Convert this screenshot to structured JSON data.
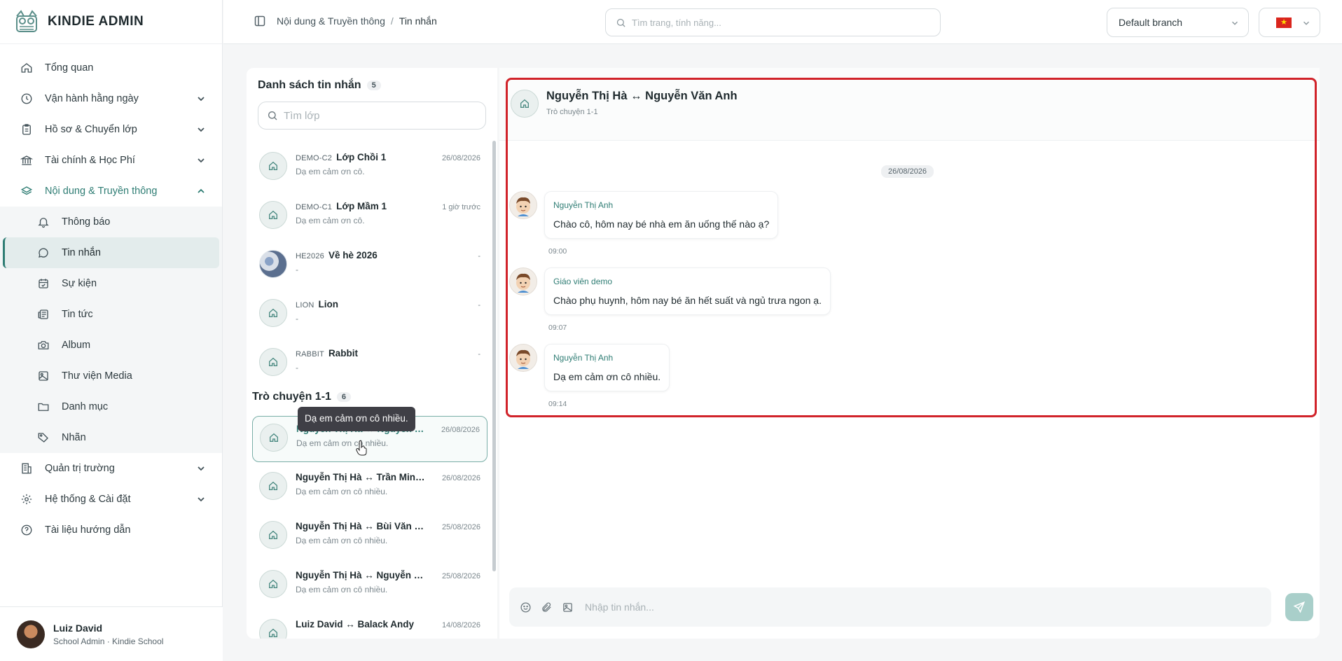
{
  "brand": {
    "name": "KINDIE ADMIN"
  },
  "sidebar": {
    "items": [
      {
        "label": "Tổng quan",
        "icon": "home-icon"
      },
      {
        "label": "Vận hành hằng ngày",
        "icon": "clock-icon"
      },
      {
        "label": "Hồ sơ & Chuyển lớp",
        "icon": "clipboard-icon"
      },
      {
        "label": "Tài chính & Học Phí",
        "icon": "bank-icon"
      },
      {
        "label": "Nội dung & Truyền thông",
        "icon": "layers-icon"
      }
    ],
    "sub_items": [
      {
        "label": "Thông báo",
        "icon": "bell-icon"
      },
      {
        "label": "Tin nhắn",
        "icon": "chat-icon"
      },
      {
        "label": "Sự kiện",
        "icon": "calendar-icon"
      },
      {
        "label": "Tin tức",
        "icon": "newspaper-icon"
      },
      {
        "label": "Album",
        "icon": "camera-icon"
      },
      {
        "label": "Thư viện Media",
        "icon": "image-icon"
      },
      {
        "label": "Danh mục",
        "icon": "folder-icon"
      },
      {
        "label": "Nhãn",
        "icon": "tag-icon"
      }
    ],
    "bottom_items": [
      {
        "label": "Quản trị trường",
        "icon": "building-icon"
      },
      {
        "label": "Hệ thống & Cài đặt",
        "icon": "gear-icon"
      },
      {
        "label": "Tài liệu hướng dẫn",
        "icon": "help-icon"
      }
    ]
  },
  "user": {
    "name": "Luiz David",
    "role": "School Admin · Kindie School"
  },
  "header": {
    "breadcrumb": [
      "Nội dung & Truyền thông",
      "Tin nhắn"
    ],
    "search_placeholder": "Tìm trang, tính năng...",
    "branch": "Default branch",
    "flag_star": "★"
  },
  "list": {
    "title": "Danh sách tin nhắn",
    "count": "5",
    "search_placeholder": "Tìm lớp",
    "classes": [
      {
        "code": "DEMO-C2",
        "name": "Lớp Chồi 1",
        "time": "26/08/2026",
        "preview": "Dạ em cảm ơn cô."
      },
      {
        "code": "DEMO-C1",
        "name": "Lớp Mầm 1",
        "time": "1 giờ trước",
        "preview": "Dạ em cảm ơn cô."
      },
      {
        "code": "HE2026",
        "name": "Về hè 2026",
        "time": "-",
        "preview": "-"
      },
      {
        "code": "LION",
        "name": "Lion",
        "time": "-",
        "preview": "-"
      },
      {
        "code": "RABBIT",
        "name": "Rabbit",
        "time": "-",
        "preview": "-"
      }
    ],
    "dm_title": "Trò chuyện 1-1",
    "dm_count": "6",
    "dms": [
      {
        "name": "Nguyễn Thị Hà ↔ Nguyễn Văn A...",
        "time": "26/08/2026",
        "preview": "Dạ em cảm ơn cô nhiều."
      },
      {
        "name": "Nguyễn Thị Hà ↔ Trần Minh Bình",
        "time": "26/08/2026",
        "preview": "Dạ em cảm ơn cô nhiều."
      },
      {
        "name": "Nguyễn Thị Hà ↔ Bùi Văn Kiên",
        "time": "25/08/2026",
        "preview": "Dạ em cảm ơn cô nhiều."
      },
      {
        "name": "Nguyễn Thị Hà ↔ Nguyễn Minh ...",
        "time": "25/08/2026",
        "preview": "Dạ em cảm ơn cô nhiều."
      },
      {
        "name": "Luiz David ↔ Balack Andy",
        "time": "14/08/2026",
        "preview": ""
      }
    ],
    "tooltip": "Dạ em cảm ơn cô nhiều."
  },
  "chat": {
    "title": "Nguyễn Thị Hà ↔ Nguyễn Văn Anh",
    "subtitle": "Trò chuyện 1-1",
    "date": "26/08/2026",
    "messages": [
      {
        "sender": "Nguyễn Thị Anh",
        "text": "Chào cô, hôm nay bé nhà em ăn uống thế nào ạ?",
        "time": "09:00"
      },
      {
        "sender": "Giáo viên demo",
        "text": "Chào phụ huynh, hôm nay bé ăn hết suất và ngủ trưa ngon ạ.",
        "time": "09:07"
      },
      {
        "sender": "Nguyễn Thị Anh",
        "text": "Dạ em cảm ơn cô nhiều.",
        "time": "09:14"
      }
    ],
    "composer_placeholder": "Nhập tin nhắn..."
  },
  "colors": {
    "accent": "#2f7d74",
    "highlight": "#d1232a",
    "send": "#a9cfca"
  }
}
